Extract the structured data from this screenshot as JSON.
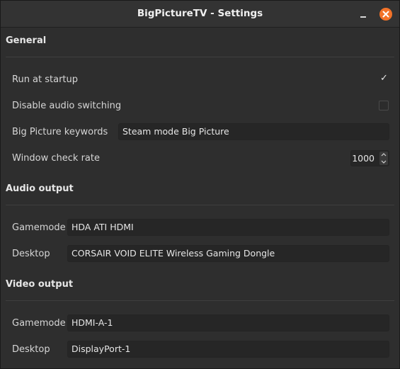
{
  "window": {
    "title": "BigPictureTV - Settings"
  },
  "general": {
    "title": "General",
    "run_at_startup": {
      "label": "Run at startup",
      "checked": true,
      "mark": "✓"
    },
    "disable_audio_switching": {
      "label": "Disable audio switching",
      "checked": false
    },
    "keywords": {
      "label": "Big Picture keywords",
      "value": "Steam mode Big Picture"
    },
    "window_check_rate": {
      "label": "Window check rate",
      "value": "1000"
    }
  },
  "audio_output": {
    "title": "Audio output",
    "gamemode": {
      "label": "Gamemode",
      "value": "HDA ATI HDMI"
    },
    "desktop": {
      "label": "Desktop",
      "value": "CORSAIR VOID ELITE Wireless Gaming Dongle"
    }
  },
  "video_output": {
    "title": "Video output",
    "gamemode": {
      "label": "Gamemode",
      "value": "HDMI-A-1"
    },
    "desktop": {
      "label": "Desktop",
      "value": "DisplayPort-1"
    }
  },
  "colors": {
    "close_button": "#f37329",
    "background": "#2e2e2e"
  }
}
